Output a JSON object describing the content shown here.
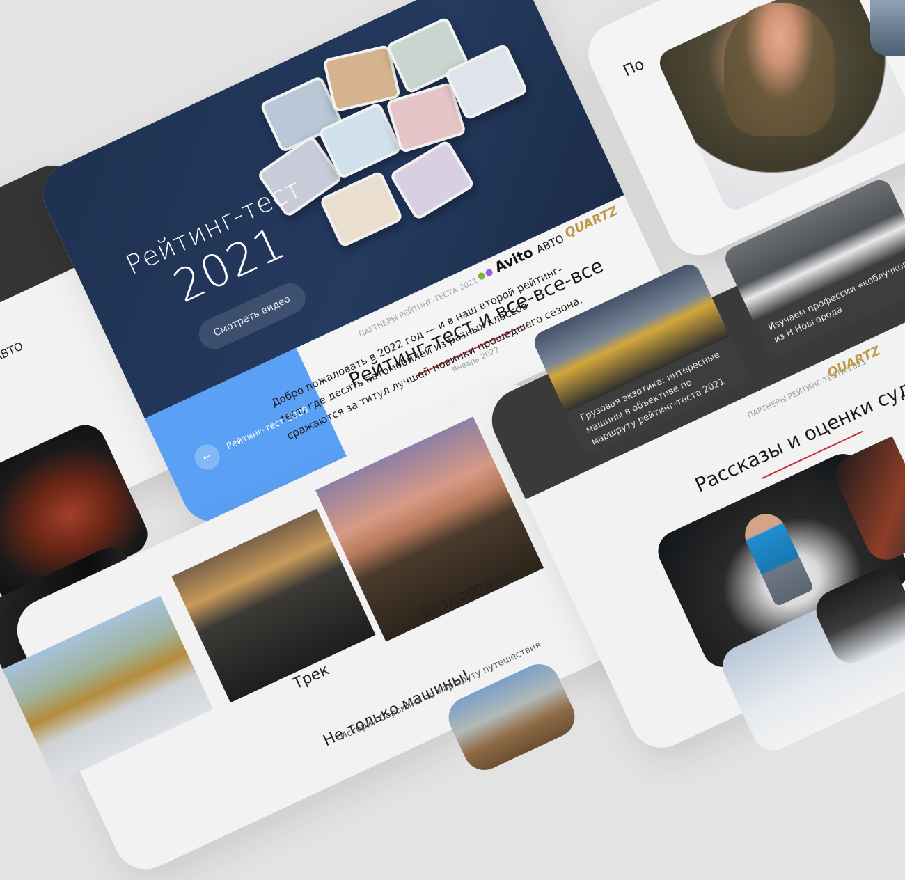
{
  "hero": {
    "title_line1": "Рейтинг-тест",
    "title_line2": "2021",
    "video_button": "Смотреть видео",
    "prev_link": "Рейтинг-тест 2020",
    "back_arrow": "←",
    "partners_label": "ПАРТНЕРЫ РЕЙТИНГ-ТЕСТА 2021",
    "partner_avito": "Avito",
    "partner_avito_suffix": "АВТО",
    "partner_quartz": "QUARTZ",
    "article_title": "Рейтинг-тест и все-все-все",
    "article_date": "Январь 2022",
    "article_body": "Добро пожаловать в 2022 год — и в наш второй рейтинг-тест, где десять автомобилей из разных классов сражаются за титул лучшей новинки прошедшего сезона."
  },
  "gallery": {
    "track_label": "Трек",
    "offroad_label": "Бездорожье",
    "not_only_title": "Не только машины!",
    "not_only_sub": "Истории Сорокина по маршруту путешествия"
  },
  "stories": {
    "caption_trucks": "Грузовая экзотика: интересные машины в объективе по маршруту рейтинг-теста 2021",
    "caption_kobluk": "Изучаем профессии «коблучков» из Н Новгорода",
    "partners_label": "ПАРТНЕРЫ РЕЙТИНГ-ТЕСТА 2021",
    "partner_quartz": "QUARTZ",
    "section_title": "Рассказы и оценки суд"
  },
  "left_card": {
    "partner_text": "АВТО"
  },
  "top_right": {
    "fragment_text": "По"
  },
  "colors": {
    "navy": "#223759",
    "accent_blue": "#5aa0f4",
    "red": "#c62f35",
    "dark": "#3a3a3a"
  }
}
